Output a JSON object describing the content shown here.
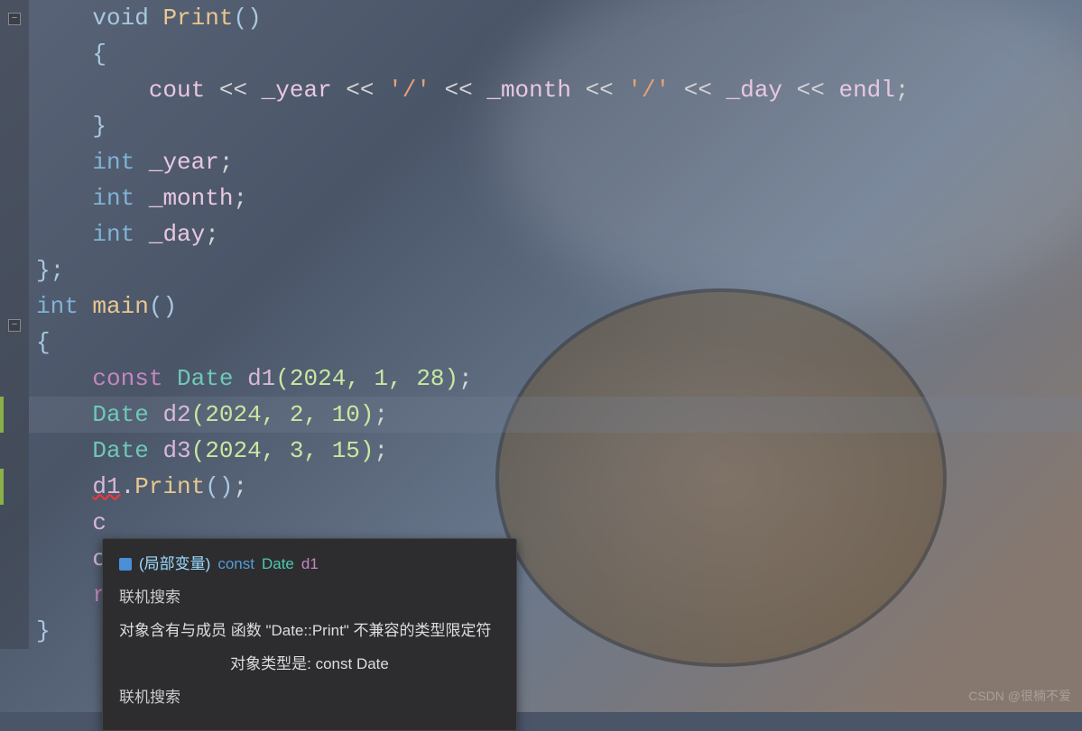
{
  "code": {
    "line1": {
      "kw_void": "void",
      "func": "Print",
      "parens": "()"
    },
    "line2": {
      "brace": "{"
    },
    "line3": {
      "cout": "cout",
      "op1": " << ",
      "m1": "_year",
      "op2": " << ",
      "s1": "'/'",
      "op3": " << ",
      "m2": "_month",
      "op4": " << ",
      "s2": "'/'",
      "op5": " << ",
      "m3": "_day",
      "op6": " << ",
      "endl": "endl",
      "semi": ";"
    },
    "line4": {
      "brace": "}"
    },
    "line5": {
      "type": "int",
      "member": "_year",
      "semi": ";"
    },
    "line6": {
      "type": "int",
      "member": "_month",
      "semi": ";"
    },
    "line7": {
      "type": "int",
      "member": "_day",
      "semi": ";"
    },
    "line8": {
      "brace": "};"
    },
    "line9": {
      "type": "int",
      "func": "main",
      "parens": "()"
    },
    "line10": {
      "brace": "{"
    },
    "line11": {
      "const": "const",
      "cls": "Date",
      "var": "d1",
      "args": "(2024, 1, 28)",
      "semi": ";"
    },
    "line12": {
      "cls": "Date",
      "var": "d2",
      "args": "(2024, 2, 10)",
      "semi": ";"
    },
    "line13": {
      "cls": "Date",
      "var": "d3",
      "args": "(2024, 3, 15)",
      "semi": ";"
    },
    "line14": {
      "obj": "d1",
      "dot": ".",
      "method": "Print",
      "parens": "()",
      "semi": ";"
    },
    "line15": {
      "partial": "c"
    },
    "line16": {
      "partial": "c"
    },
    "line17": {
      "partial": "r"
    },
    "line18": {
      "brace": "}"
    }
  },
  "tooltip": {
    "scope_label": "(局部变量)",
    "const_kw": "const",
    "type_name": "Date",
    "var_name": "d1",
    "search1": "联机搜索",
    "error_line1": "对象含有与成员 函数 \"Date::Print\" 不兼容的类型限定符",
    "error_line2": "对象类型是:  const Date",
    "search2": "联机搜索"
  },
  "watermark": "CSDN @很楠不爱"
}
